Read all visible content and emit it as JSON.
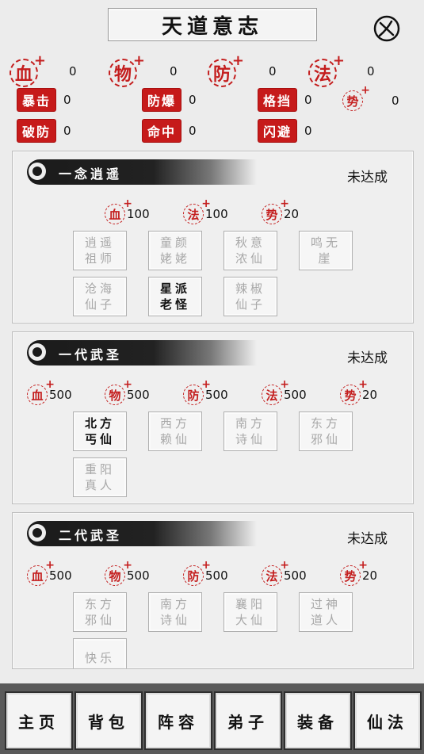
{
  "title": "天道意志",
  "stats": {
    "blood": {
      "glyph": "血",
      "value": "0"
    },
    "physical": {
      "glyph": "物",
      "value": "0"
    },
    "defense": {
      "glyph": "防",
      "value": "0"
    },
    "magic": {
      "glyph": "法",
      "value": "0"
    },
    "crit": {
      "label": "暴击",
      "value": "0"
    },
    "crit_resist": {
      "label": "防爆",
      "value": "0"
    },
    "block": {
      "label": "格挡",
      "value": "0"
    },
    "momentum": {
      "glyph": "势",
      "value": "0"
    },
    "pierce": {
      "label": "破防",
      "value": "0"
    },
    "hit": {
      "label": "命中",
      "value": "0"
    },
    "dodge": {
      "label": "闪避",
      "value": "0"
    }
  },
  "panels": [
    {
      "title": "一念逍遥",
      "status": "未达成",
      "bonuses": [
        {
          "glyph": "血",
          "value": "100"
        },
        {
          "glyph": "法",
          "value": "100"
        },
        {
          "glyph": "势",
          "value": "20"
        }
      ],
      "characters": [
        {
          "name": "逍遥祖师",
          "active": false
        },
        {
          "name": "童颜姥姥",
          "active": false
        },
        {
          "name": "秋意浓仙",
          "active": false
        },
        {
          "name": "鸣无崖",
          "active": false
        },
        {
          "name": "沧海仙子",
          "active": false
        },
        {
          "name": "星派老怪",
          "active": true
        },
        {
          "name": "辣椒仙子",
          "active": false
        }
      ]
    },
    {
      "title": "一代武圣",
      "status": "未达成",
      "bonuses": [
        {
          "glyph": "血",
          "value": "500"
        },
        {
          "glyph": "物",
          "value": "500"
        },
        {
          "glyph": "防",
          "value": "500"
        },
        {
          "glyph": "法",
          "value": "500"
        },
        {
          "glyph": "势",
          "value": "20"
        }
      ],
      "characters": [
        {
          "name": "北方丐仙",
          "active": true
        },
        {
          "name": "西方赖仙",
          "active": false
        },
        {
          "name": "南方诗仙",
          "active": false
        },
        {
          "name": "东方邪仙",
          "active": false
        },
        {
          "name": "重阳真人",
          "active": false
        }
      ]
    },
    {
      "title": "二代武圣",
      "status": "未达成",
      "bonuses": [
        {
          "glyph": "血",
          "value": "500"
        },
        {
          "glyph": "物",
          "value": "500"
        },
        {
          "glyph": "防",
          "value": "500"
        },
        {
          "glyph": "法",
          "value": "500"
        },
        {
          "glyph": "势",
          "value": "20"
        }
      ],
      "characters": [
        {
          "name": "东方邪仙",
          "active": false
        },
        {
          "name": "南方诗仙",
          "active": false
        },
        {
          "name": "襄阳大仙",
          "active": false
        },
        {
          "name": "过神道人",
          "active": false
        },
        {
          "name": "快乐",
          "active": false
        }
      ]
    }
  ],
  "nav": [
    "主页",
    "背包",
    "阵容",
    "弟子",
    "装备",
    "仙法"
  ],
  "colors": {
    "seal_red": "#c41e1e",
    "tag_red": "#c61a1a",
    "nav_bar": "#5a5a5a"
  }
}
